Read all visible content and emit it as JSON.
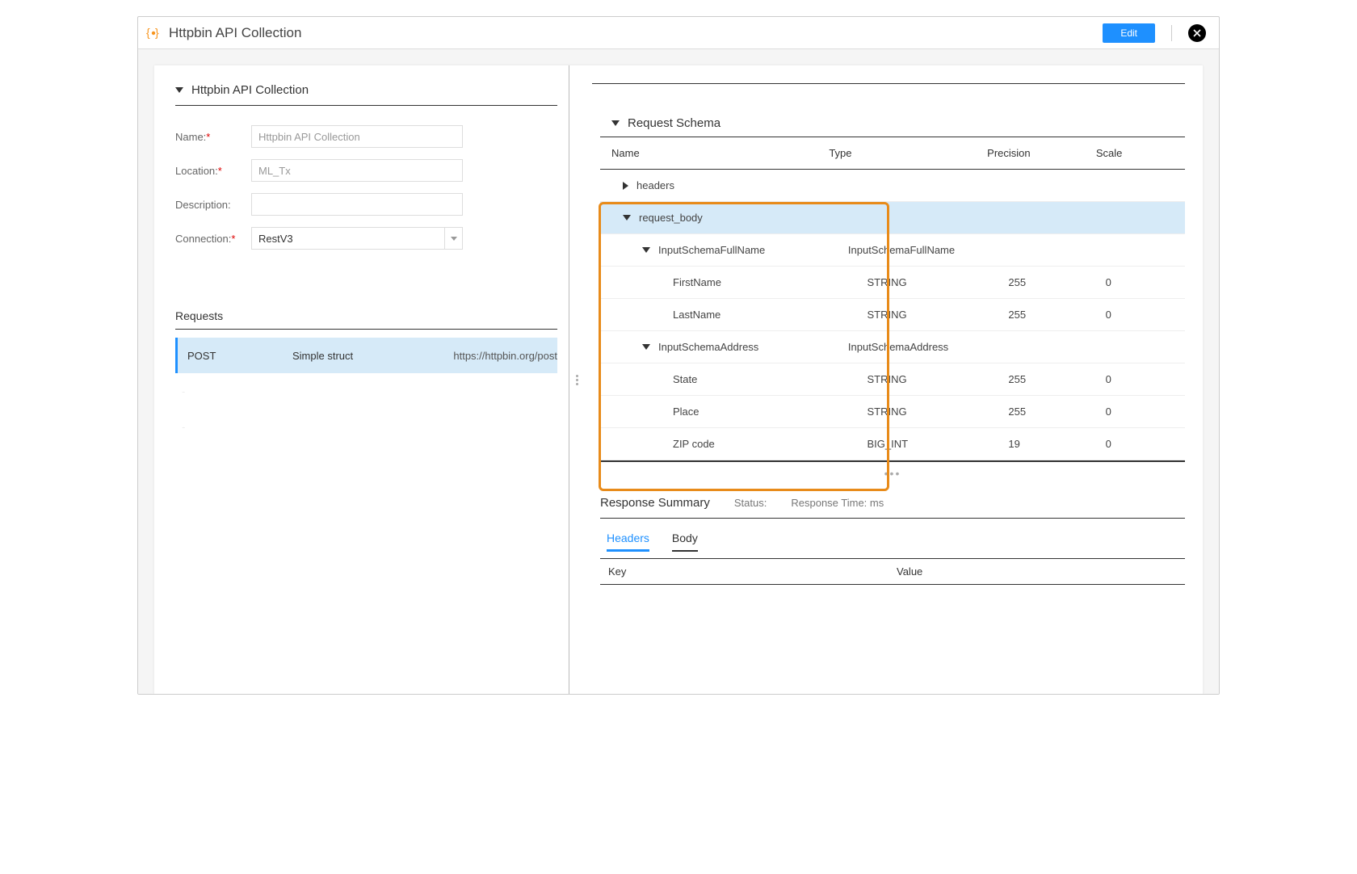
{
  "header": {
    "title": "Httpbin API Collection",
    "edit_label": "Edit"
  },
  "left": {
    "section_title": "Httpbin API Collection",
    "fields": {
      "name_label": "Name:",
      "name_value": "Httpbin API Collection",
      "location_label": "Location:",
      "location_value": "ML_Tx",
      "description_label": "Description:",
      "description_value": "",
      "connection_label": "Connection:",
      "connection_value": "RestV3"
    },
    "requests_label": "Requests",
    "request": {
      "method": "POST",
      "name": "Simple struct",
      "url": "https://httpbin.org/post"
    }
  },
  "right": {
    "schema_title": "Request Schema",
    "columns": {
      "name": "Name",
      "type": "Type",
      "precision": "Precision",
      "scale": "Scale"
    },
    "rows": {
      "headers_label": "headers",
      "request_body_label": "request_body",
      "fullname_label": "InputSchemaFullName",
      "fullname_type": "InputSchemaFullName",
      "firstname_label": "FirstName",
      "firstname_type": "STRING",
      "firstname_prec": "255",
      "firstname_scale": "0",
      "lastname_label": "LastName",
      "lastname_type": "STRING",
      "lastname_prec": "255",
      "lastname_scale": "0",
      "address_label": "InputSchemaAddress",
      "address_type": "InputSchemaAddress",
      "state_label": "State",
      "state_type": "STRING",
      "state_prec": "255",
      "state_scale": "0",
      "place_label": "Place",
      "place_type": "STRING",
      "place_prec": "255",
      "place_scale": "0",
      "zip_label": "ZIP code",
      "zip_type": "BIG_INT",
      "zip_prec": "19",
      "zip_scale": "0"
    },
    "response_summary": {
      "label": "Response Summary",
      "status_label": "Status:",
      "time_label": "Response Time: ms"
    },
    "tabs": {
      "headers": "Headers",
      "body": "Body"
    },
    "kv": {
      "key": "Key",
      "value": "Value"
    }
  }
}
